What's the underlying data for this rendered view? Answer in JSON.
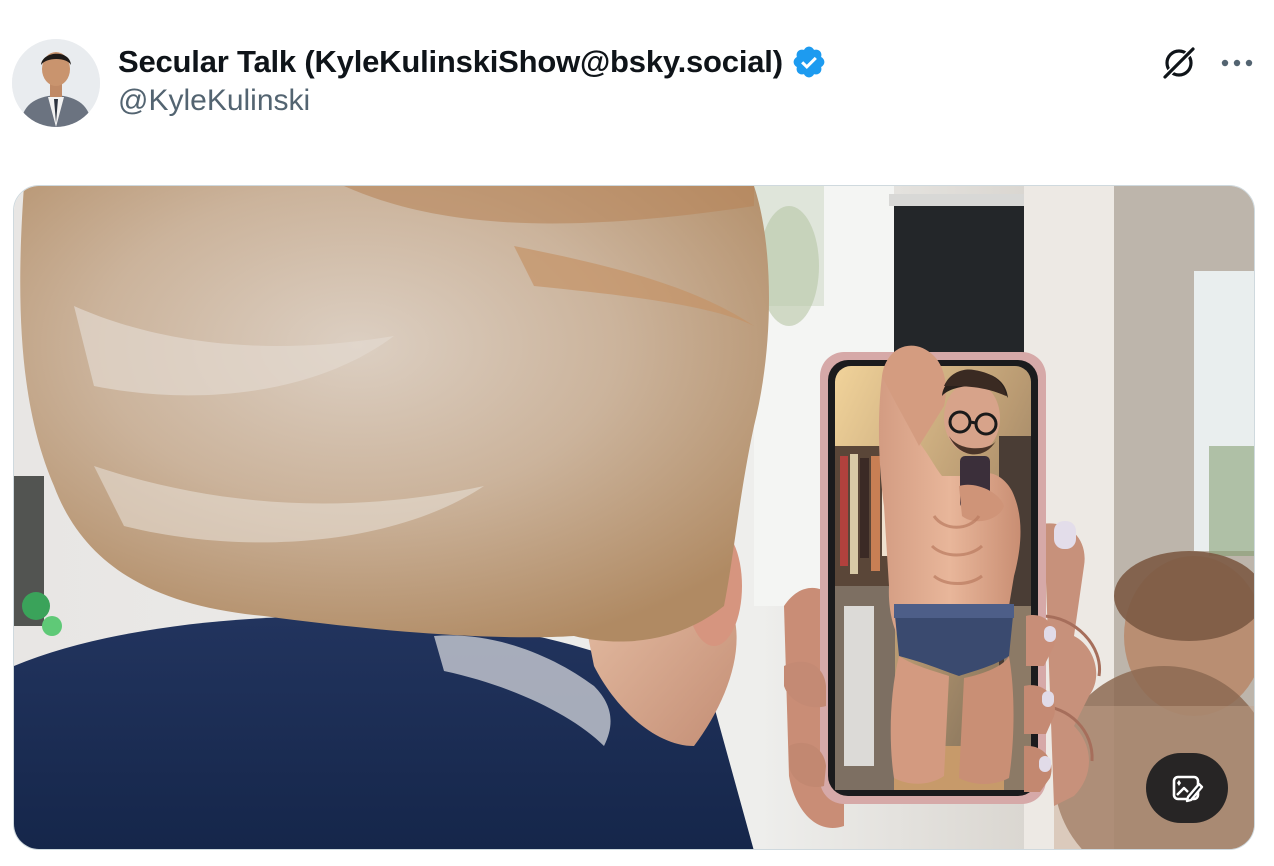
{
  "tweet": {
    "author": {
      "display_name": "Secular Talk (KyleKulinskiShow@bsky.social)",
      "handle": "@KyleKulinski",
      "verified": true,
      "verified_color": "#1d9bf0",
      "avatar_icon": "profile-photo"
    },
    "actions": {
      "grok_icon": "grok-icon",
      "more_icon": "more-horizontal-icon"
    },
    "media": {
      "type": "photo",
      "badge_icon": "image-edit-icon"
    }
  }
}
